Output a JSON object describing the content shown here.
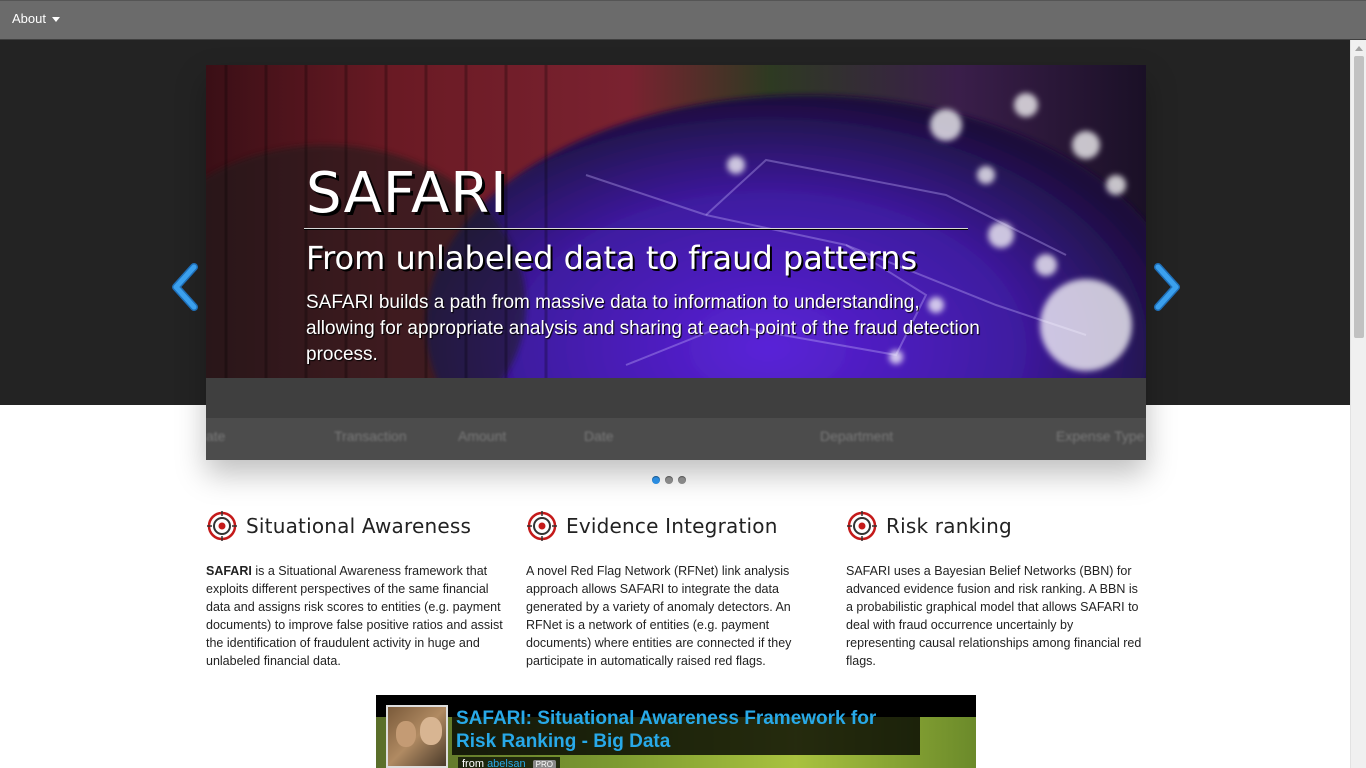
{
  "navbar": {
    "about_label": "About"
  },
  "hero": {
    "title": "SAFARI",
    "subtitle": "From unlabeled data to fraud patterns",
    "body": "SAFARI builds a path from massive data to information to understanding, allowing for appropriate analysis and sharing at each point of the fraud detection process.",
    "columns": [
      "ate",
      "Transaction",
      "Amount",
      "Date",
      "Department",
      "Expense Type"
    ],
    "dots_count": 3,
    "active_dot": 0
  },
  "features": [
    {
      "title": "Situational Awareness",
      "lead": "SAFARI",
      "text": " is a Situational Awareness framework that exploits different perspectives of the same financial data and assigns risk scores to entities (e.g. payment documents) to improve false positive ratios and assist the identification of fraudulent activity in huge and unlabeled financial data."
    },
    {
      "title": "Evidence Integration",
      "text": "A novel Red Flag Network (RFNet) link analysis approach allows SAFARI to integrate the data generated by a variety of anomaly detectors. An RFNet is a network of entities (e.g. payment documents) where entities are connected if they participate in automatically raised red flags."
    },
    {
      "title": "Risk ranking",
      "text": "SAFARI uses a Bayesian Belief Networks (BBN) for advanced evidence fusion and risk ranking. A BBN is a probabilistic graphical model that allows SAFARI to deal with fraud occurrence uncertainly by representing causal relationships among financial red flags."
    }
  ],
  "video": {
    "title": "SAFARI: Situational Awareness Framework for Risk Ranking - Big Data",
    "from_label": "from",
    "user": "abelsan",
    "badge": "PRO"
  },
  "colors": {
    "accent": "#2a8ce0",
    "link": "#28a9e8",
    "navbar": "#6b6b6b",
    "band": "#232323"
  }
}
